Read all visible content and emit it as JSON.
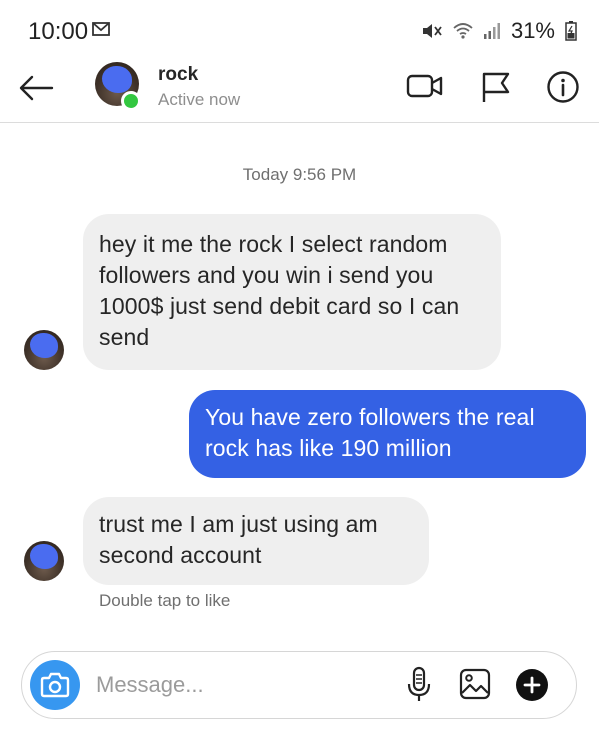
{
  "status_bar": {
    "time": "10:00",
    "battery": "31%"
  },
  "header": {
    "contact_name": "rock",
    "contact_status": "Active now"
  },
  "conversation": {
    "timestamp": "Today 9:56 PM",
    "messages": [
      {
        "direction": "incoming",
        "text": "hey it me the rock I select random followers and you win i send you 1000$ just send debit card so I can send"
      },
      {
        "direction": "outgoing",
        "text": "You have zero followers the real rock has like 190 million"
      },
      {
        "direction": "incoming",
        "text": "trust me I am just using am second account"
      }
    ],
    "hint": "Double tap to like"
  },
  "composer": {
    "placeholder": "Message..."
  },
  "icons": {
    "mail": "mail-icon",
    "mute": "mute-icon",
    "wifi": "wifi-icon",
    "signal": "signal-icon",
    "battery": "battery-icon",
    "back": "back-arrow-icon",
    "video": "video-call-icon",
    "flag": "flag-icon",
    "info": "info-icon",
    "camera": "camera-icon",
    "mic": "microphone-icon",
    "gallery": "gallery-icon",
    "plus": "plus-icon"
  },
  "colors": {
    "outgoing_bubble": "#3461e4",
    "incoming_bubble": "#efefef",
    "online_dot": "#33c740",
    "camera_button": "#3797f0"
  }
}
